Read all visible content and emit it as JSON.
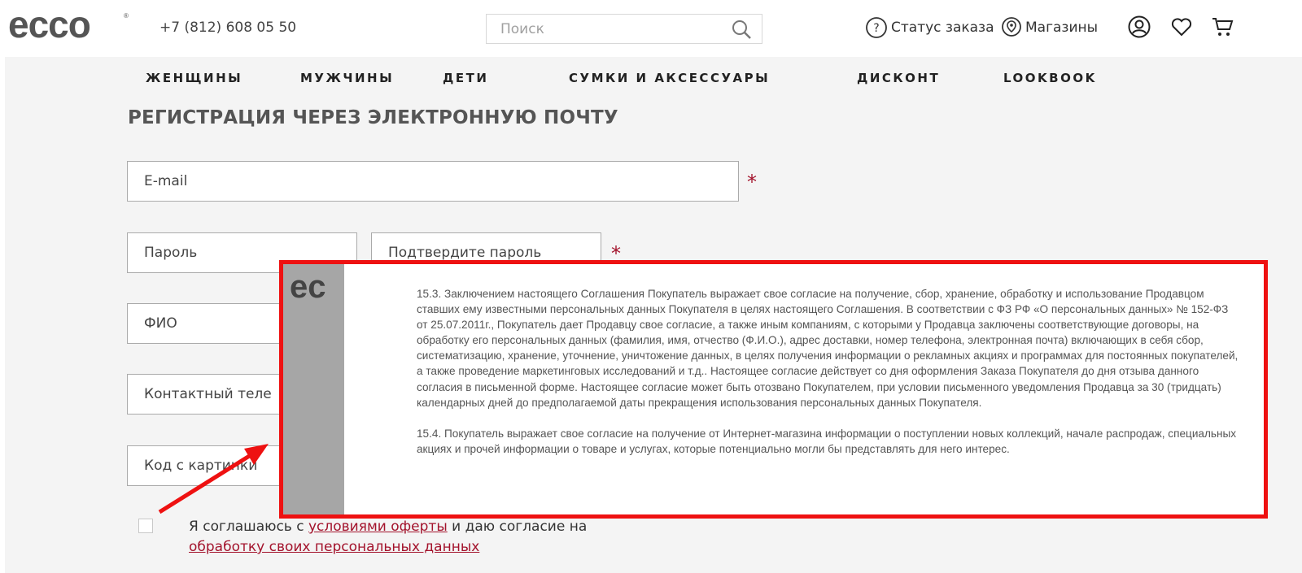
{
  "header": {
    "logo_text": "ecco",
    "phone": "+7 (812) 608 05 50",
    "search_placeholder": "Поиск",
    "order_status": "Статус заказа",
    "stores": "Магазины",
    "icons": [
      "search-icon",
      "help-icon",
      "location-icon",
      "account-icon",
      "heart-icon",
      "cart-icon"
    ]
  },
  "nav": {
    "items": [
      "ЖЕНЩИНЫ",
      "МУЖЧИНЫ",
      "ДЕТИ",
      "СУМКИ И АКСЕССУАРЫ",
      "ДИСКОНТ",
      "LOOKBOOK"
    ]
  },
  "form": {
    "title": "РЕГИСТРАЦИЯ ЧЕРЕЗ ЭЛЕКТРОННУЮ ПОЧТУ",
    "email": "E-mail",
    "password": "Пароль",
    "confirm_password": "Подтвердите пароль",
    "fio": "ФИО",
    "phone": "Контактный теле",
    "captcha": "Код с картинки",
    "required_mark": "*",
    "consent_prefix": "Я соглашаюсь с ",
    "consent_link1": "условиями оферты",
    "consent_middle": " и даю согласие на",
    "consent_link2": "обработку своих персональных данных"
  },
  "overlay": {
    "logo_text": "ec",
    "p1": "15.3. Заключением настоящего Соглашения Покупатель выражает свое согласие на получение, сбор, хранение, обработку и использование Продавцом ставших ему известными персональных данных Покупателя в целях настоящего Соглашения. В соответствии с ФЗ РФ «О персональных данных» № 152-ФЗ от 25.07.2011г., Покупатель дает Продавцу свое согласие, а также иным компаниям, с которыми у Продавца заключены соответствующие договоры, на обработку его персональных данных (фамилия, имя, отчество (Ф.И.О.), адрес доставки, номер телефона, электронная почта) включающих в себя сбор, систематизацию, хранение, уточнение, уничтожение данных, в целях получения информации о рекламных акциях и программах для постоянных покупателей, а также проведение маркетинговых исследований и т.д.. Настоящее согласие действует со дня оформления Заказа Покупателя до дня отзыва данного согласия в письменной форме. Настоящее согласие может быть отозвано Покупателем, при условии письменного уведомления Продавца за 30 (тридцать) календарных дней до предполагаемой даты прекращения использования персональных данных Покупателя.",
    "p2": "15.4. Покупатель выражает свое согласие на получение от Интернет-магазина информации о поступлении новых коллекций, начале распродаж, специальных акциях и прочей информации о товаре и услугах, которые потенциально могли бы представлять для него интерес."
  },
  "colors": {
    "accent_red": "#a3132c",
    "annotation_red": "#ee1111",
    "nav_bg": "#f4f4f4"
  }
}
